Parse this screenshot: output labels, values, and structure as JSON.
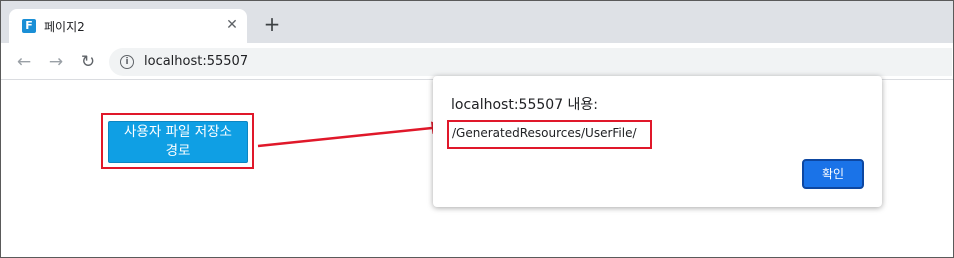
{
  "browser": {
    "tab": {
      "favicon_letter": "F",
      "title": "페이지2",
      "close_glyph": "✕"
    },
    "new_tab_glyph": "+",
    "nav": {
      "back_glyph": "←",
      "forward_glyph": "→",
      "reload_glyph": "↻"
    },
    "address": {
      "info_glyph": "i",
      "url": "localhost:55507"
    }
  },
  "page": {
    "button_label_line1": "사용자 파일 저장소",
    "button_label_line2": "경로",
    "highlight_color": "#e0182a",
    "button_color": "#0f9fe4"
  },
  "dialog": {
    "title": "localhost:55507 내용:",
    "message": "/GeneratedResources/UserFile/",
    "ok_label": "확인",
    "ok_color": "#1a73e8"
  }
}
